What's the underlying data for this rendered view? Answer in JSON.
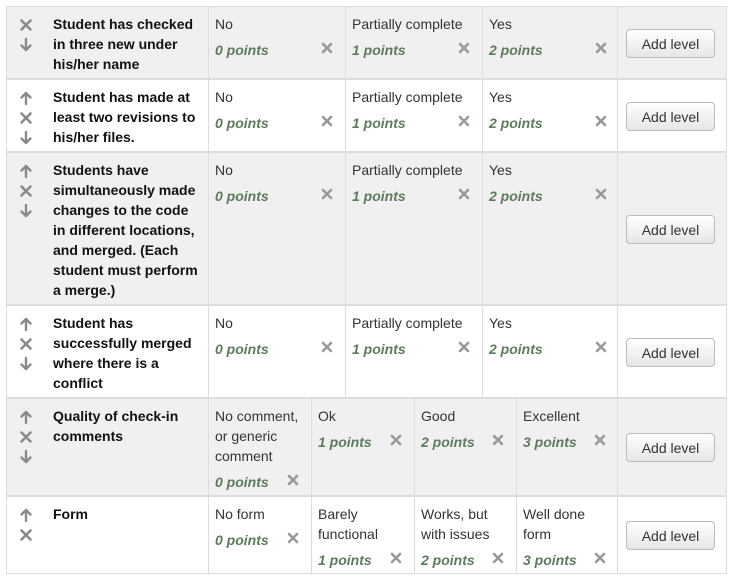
{
  "rubric": {
    "criteria": [
      {
        "description": "Student has checked in three new under his/her name",
        "controls": [
          "close-icon",
          "arrow-down-icon"
        ],
        "levels": [
          {
            "definition": "No",
            "points": "0 points"
          },
          {
            "definition": "Partially complete",
            "points": "1 points"
          },
          {
            "definition": "Yes",
            "points": "2 points"
          }
        ],
        "add_level_label": "Add level"
      },
      {
        "description": "Student has made at least two revisions to his/her files.",
        "controls": [
          "arrow-up-icon",
          "close-icon",
          "arrow-down-icon"
        ],
        "levels": [
          {
            "definition": "No",
            "points": "0 points"
          },
          {
            "definition": "Partially complete",
            "points": "1 points"
          },
          {
            "definition": "Yes",
            "points": "2 points"
          }
        ],
        "add_level_label": "Add level"
      },
      {
        "description": "Students have simultaneously made changes to the code in different locations, and merged. (Each student must perform a merge.)",
        "controls": [
          "arrow-up-icon",
          "close-icon",
          "arrow-down-icon"
        ],
        "levels": [
          {
            "definition": "No",
            "points": "0 points"
          },
          {
            "definition": "Partially complete",
            "points": "1 points"
          },
          {
            "definition": "Yes",
            "points": "2 points"
          }
        ],
        "add_level_label": "Add level"
      },
      {
        "description": "Student has successfully merged where there is a conflict",
        "controls": [
          "arrow-up-icon",
          "close-icon",
          "arrow-down-icon"
        ],
        "levels": [
          {
            "definition": "No",
            "points": "0 points"
          },
          {
            "definition": "Partially complete",
            "points": "1 points"
          },
          {
            "definition": "Yes",
            "points": "2 points"
          }
        ],
        "add_level_label": "Add level"
      },
      {
        "description": "Quality of check-in comments",
        "controls": [
          "arrow-up-icon",
          "close-icon",
          "arrow-down-icon"
        ],
        "levels": [
          {
            "definition": "No comment, or generic comment",
            "points": "0 points"
          },
          {
            "definition": "Ok",
            "points": "1 points"
          },
          {
            "definition": "Good",
            "points": "2 points"
          },
          {
            "definition": "Excellent",
            "points": "3 points"
          }
        ],
        "add_level_label": "Add level"
      },
      {
        "description": "Form",
        "controls": [
          "arrow-up-icon",
          "close-icon"
        ],
        "levels": [
          {
            "definition": "No form",
            "points": "0 points"
          },
          {
            "definition": "Barely functional",
            "points": "1 points"
          },
          {
            "definition": "Works, but with issues",
            "points": "2 points"
          },
          {
            "definition": "Well done form",
            "points": "3 points"
          }
        ],
        "add_level_label": "Add level"
      }
    ]
  }
}
